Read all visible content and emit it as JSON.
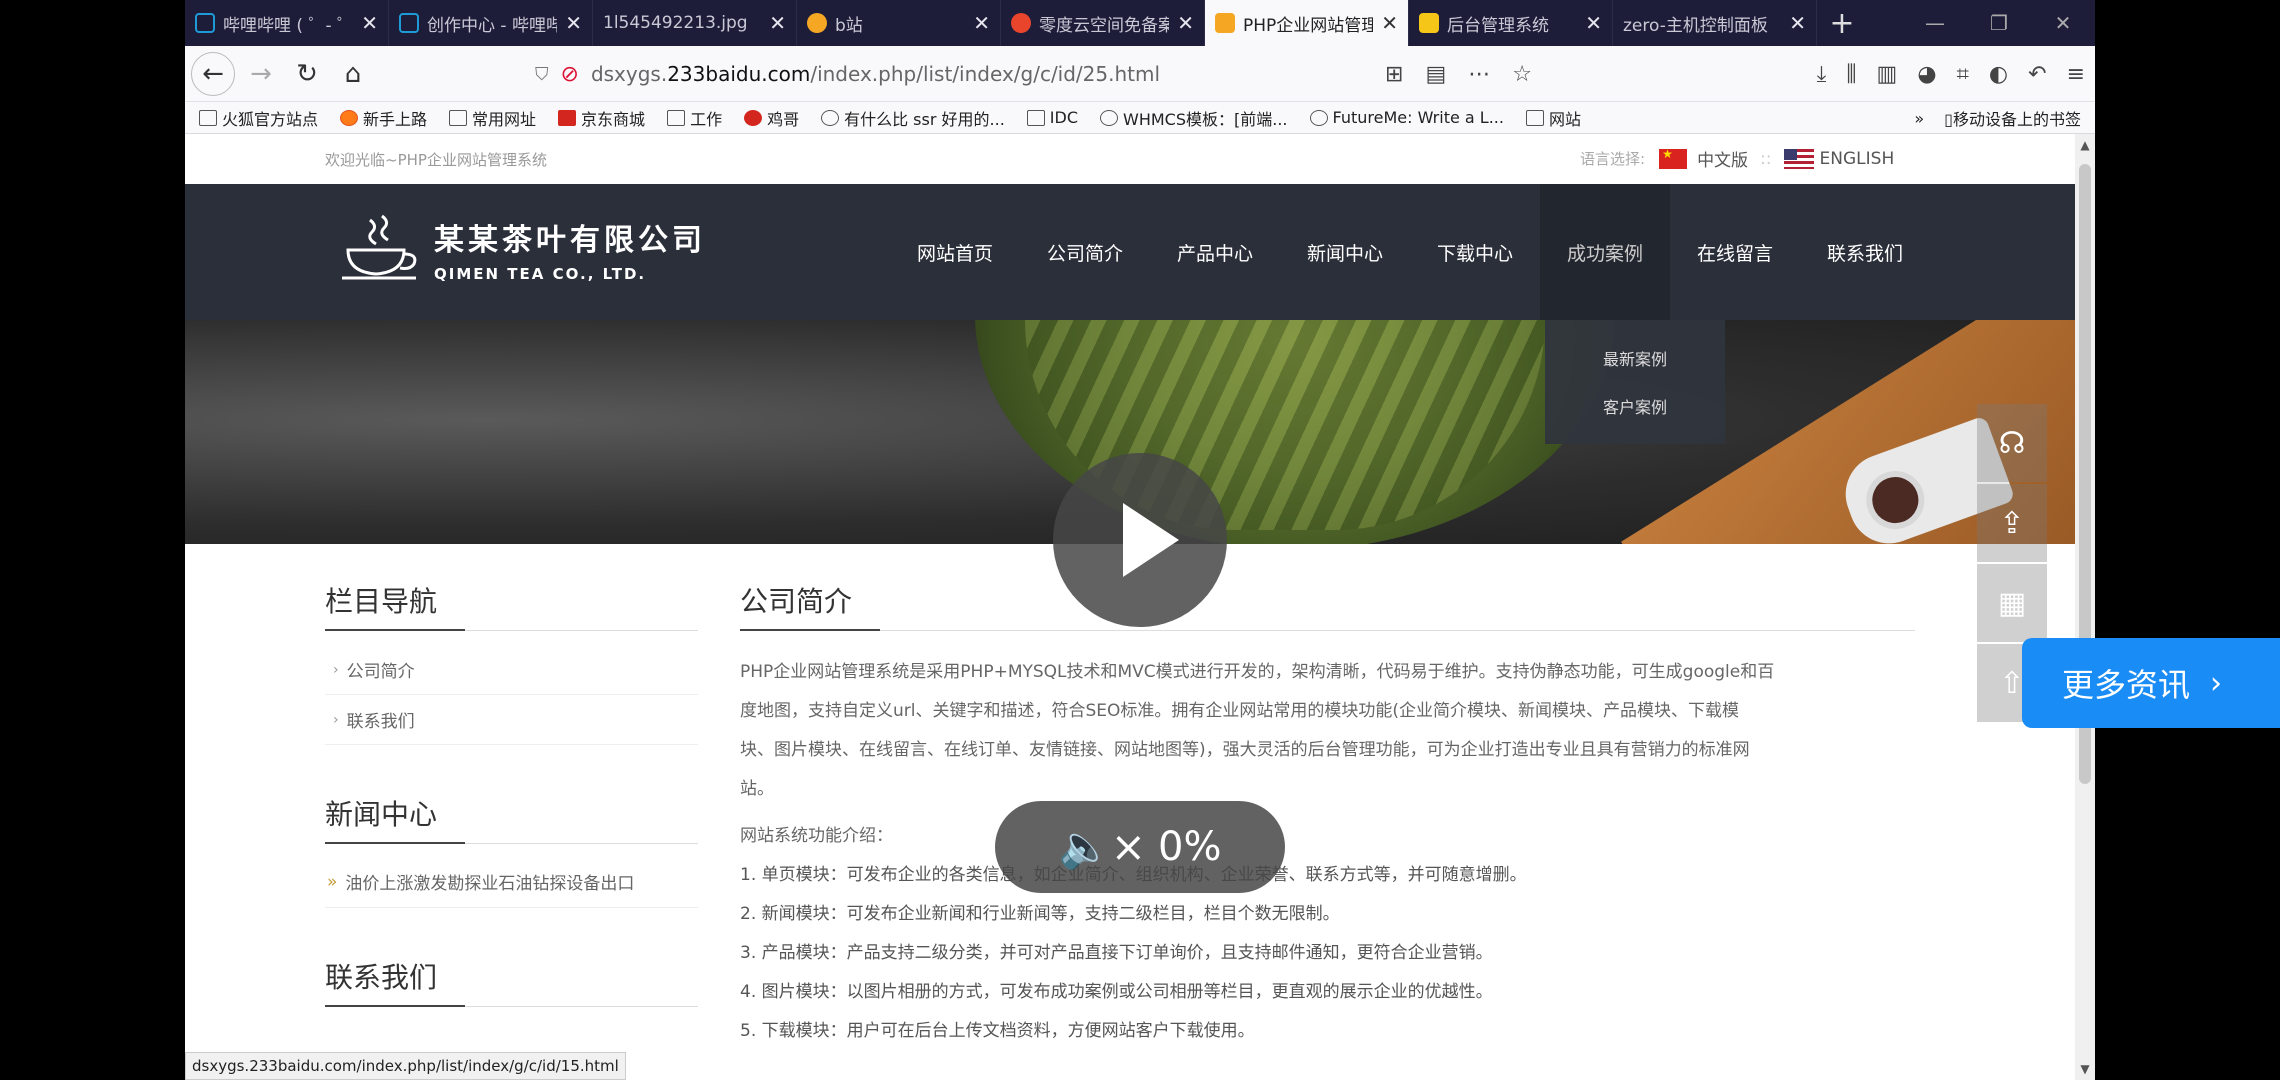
{
  "tabs": [
    {
      "label": "哔哩哔哩 ( ゜- ゜)つロ",
      "color": "#1e9bd7",
      "active": false
    },
    {
      "label": "创作中心 - 哔哩哔哩",
      "color": "#1e9bd7",
      "active": false
    },
    {
      "label": "1l545492213.jpg",
      "color": "",
      "active": false
    },
    {
      "label": "b站",
      "color": "#f5a623",
      "active": false
    },
    {
      "label": "零度云空间免备案",
      "color": "#e8452c",
      "active": false
    },
    {
      "label": "PHP企业网站管理",
      "color": "#f5a623",
      "active": true
    },
    {
      "label": "后台管理系统",
      "color": "#f5c518",
      "active": false
    },
    {
      "label": "zero-主机控制面板",
      "color": "",
      "active": false
    }
  ],
  "address": {
    "prefix": "dsxygs.",
    "host": "233baidu.com",
    "path": "/index.php/list/index/g/c/id/25.html"
  },
  "bookmarks": [
    {
      "label": "火狐官方站点",
      "icon": "folder-icon"
    },
    {
      "label": "新手上路",
      "icon": "firefox-icon"
    },
    {
      "label": "常用网址",
      "icon": "folder-icon"
    },
    {
      "label": "京东商城",
      "icon": "jd-icon"
    },
    {
      "label": "工作",
      "icon": "folder-icon"
    },
    {
      "label": "鸡哥",
      "icon": "p-icon"
    },
    {
      "label": "有什么比 ssr 好用的...",
      "icon": "globe-icon"
    },
    {
      "label": "IDC",
      "icon": "folder-icon"
    },
    {
      "label": "WHMCS模板：[前端...",
      "icon": "globe-icon"
    },
    {
      "label": "FutureMe: Write a L...",
      "icon": "globe-icon"
    },
    {
      "label": "网站",
      "icon": "folder-icon"
    }
  ],
  "bookmarks_mobile": "移动设备上的书签",
  "site": {
    "welcome": "欢迎光临~PHP企业网站管理系统",
    "lang_label": "语言选择:",
    "lang_cn": "中文版",
    "lang_en": "ENGLISH",
    "logo_cn": "某某茶叶有限公司",
    "logo_en": "QIMEN TEA CO., LTD.",
    "nav": [
      "网站首页",
      "公司简介",
      "产品中心",
      "新闻中心",
      "下载中心",
      "成功案例",
      "在线留言",
      "联系我们"
    ],
    "dropdown": [
      "最新案例",
      "客户案例"
    ]
  },
  "sidebar": {
    "nav_title": "栏目导航",
    "nav_links": [
      "公司简介",
      "联系我们"
    ],
    "news_title": "新闻中心",
    "news_items": [
      "油价上涨激发勘探业石油钻探设备出口"
    ],
    "contact_title": "联系我们"
  },
  "main": {
    "title": "公司简介",
    "intro_lines": [
      "PHP企业网站管理系统是采用PHP+MYSQL技术和MVC模式进行开发的，架构清晰，代码易于维护。支持伪静态功能，可生成google和百",
      "度地图，支持自定义url、关键字和描述，符合SEO标准。拥有企业网站常用的模块功能(企业简介模块、新闻模块、产品模块、下载模",
      "块、图片模块、在线留言、在线订单、友情链接、网站地图等)，强大灵活的后台管理功能，可为企业打造出专业且具有营销力的标准网",
      "站。"
    ],
    "features_title": "网站系统功能介绍：",
    "features": [
      "1. 单页模块：可发布企业的各类信息，如企业简介、组织机构、企业荣誉、联系方式等，并可随意增删。",
      "2. 新闻模块：可发布企业新闻和行业新闻等，支持二级栏目，栏目个数无限制。",
      "3. 产品模块：产品支持二级分类，并可对产品直接下订单询价，且支持邮件通知，更符合企业营销。",
      "4. 图片模块：以图片相册的方式，可发布成功案例或公司相册等栏目，更直观的展示企业的优越性。",
      "5. 下载模块：用户可在后台上传文档资料，方便网站客户下载使用。"
    ]
  },
  "statusbar_url": "dsxygs.233baidu.com/index.php/list/index/g/c/id/15.html",
  "overlay": {
    "volume": "0%",
    "more_news": "更多资讯"
  }
}
